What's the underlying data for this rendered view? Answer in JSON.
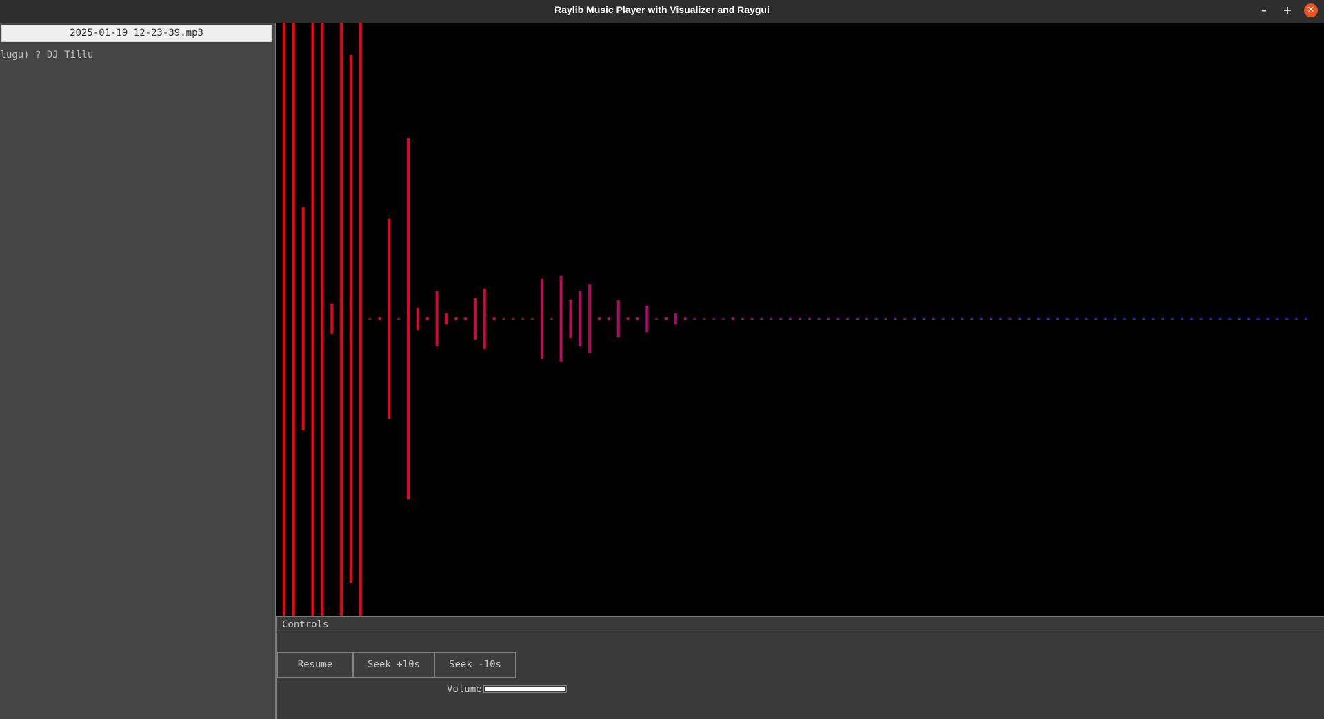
{
  "window": {
    "title": "Raylib Music Player with Visualizer and Raygui",
    "minimize_icon": "minimize-icon",
    "maximize_icon": "maximize-icon",
    "close_icon": "close-icon",
    "close_color": "#e95420"
  },
  "playlist": {
    "current_file": "2025-01-19 12-23-39.mp3",
    "items": [
      {
        "label": "elugu) ? DJ Tillu"
      }
    ]
  },
  "visualizer": {
    "background": "#000000",
    "bar_color_start": "#ff0000",
    "bar_color_end": "#1a1aff"
  },
  "controls": {
    "title": "Controls",
    "resume_label": "Resume",
    "seek_forward_label": "Seek +10s",
    "seek_back_label": "Seek -10s",
    "volume_label": "Volume",
    "volume_level": 1.0
  }
}
